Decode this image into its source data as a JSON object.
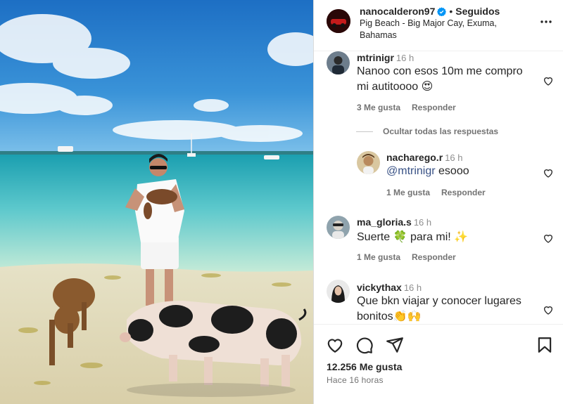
{
  "post": {
    "username": "nanocalderon97",
    "separator": "•",
    "follow_status": "Seguidos",
    "location": "Pig Beach - Big Major Cay, Exuma, Bahamas"
  },
  "comments": [
    {
      "username": "mtrinigr",
      "time": "16 h",
      "text_line1": "Nanoo con esos 10m me compro",
      "text_line2": "mi autitoooo 😍",
      "likes": "3 Me gusta",
      "reply": "Responder"
    },
    {
      "username": "nacharego.r",
      "time": "16 h",
      "mention": "@mtrinigr",
      "text": " esooo",
      "likes": "1 Me gusta",
      "reply": "Responder"
    },
    {
      "username": "ma_gloria.s",
      "time": "16 h",
      "text": "Suerte 🍀 para mi! ✨",
      "likes": "1 Me gusta",
      "reply": "Responder"
    },
    {
      "username": "vickythax",
      "time": "16 h",
      "text_line1": "Que bkn viajar y conocer lugares",
      "text_line2": "bonitos👏🙌"
    }
  ],
  "hide_replies": "Ocultar todas las respuestas",
  "footer": {
    "likes_count": "12.256 Me gusta",
    "posted": "Hace 16 horas"
  },
  "icons": {
    "like": "heart-icon",
    "comment": "comment-icon",
    "share": "share-icon",
    "save": "bookmark-icon",
    "more": "more-icon",
    "verified": "verified-badge-icon"
  },
  "colors": {
    "verified_blue": "#0095f6",
    "mention": "#385185",
    "muted": "#737373"
  }
}
